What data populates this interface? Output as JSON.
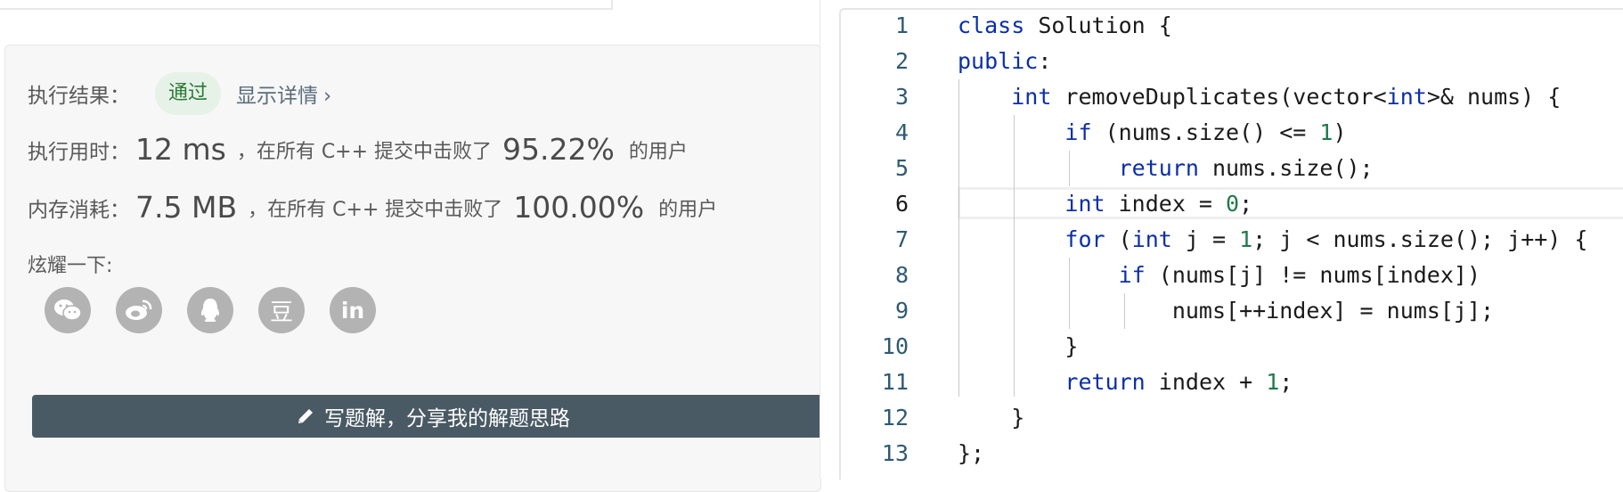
{
  "result": {
    "label": "执行结果：",
    "status": "通过",
    "details_link": "显示详情",
    "details_chevron": "›"
  },
  "runtime": {
    "label": "执行用时：",
    "value": "12 ms",
    "text": "，在所有 C++ 提交中击败了",
    "percent": "95.22%",
    "suffix": "的用户"
  },
  "memory": {
    "label": "内存消耗：",
    "value": "7.5 MB",
    "text": "，在所有 C++ 提交中击败了",
    "percent": "100.00%",
    "suffix": "的用户"
  },
  "share": {
    "label": "炫耀一下:",
    "icons": [
      "wechat-icon",
      "weibo-icon",
      "qq-icon",
      "douban-icon",
      "linkedin-icon"
    ],
    "douban_glyph": "豆",
    "linkedin_glyph": "in"
  },
  "write_button": {
    "label": "写题解，分享我的解题思路",
    "icon": "pencil-icon"
  },
  "editor": {
    "line_numbers": [
      "1",
      "2",
      "3",
      "4",
      "5",
      "6",
      "7",
      "8",
      "9",
      "10",
      "11",
      "12",
      "13"
    ],
    "active_line": "6",
    "lines": [
      "class Solution {",
      "public:",
      "    int removeDuplicates(vector<int>& nums) {",
      "        if (nums.size() <= 1)",
      "            return nums.size();",
      "        int index = 0;",
      "        for (int j = 1; j < nums.size(); j++) {",
      "            if (nums[j] != nums[index])",
      "                nums[++index] = nums[j];",
      "        }",
      "        return index + 1;",
      "    }",
      "};"
    ]
  },
  "colors": {
    "keyword": "#0b2fa8",
    "number": "#1f7a4a",
    "line_number": "#2f5a74",
    "success_badge_bg": "#e6f2e7",
    "success_badge_text": "#2b7a36",
    "button_bg": "#4a5a64"
  }
}
